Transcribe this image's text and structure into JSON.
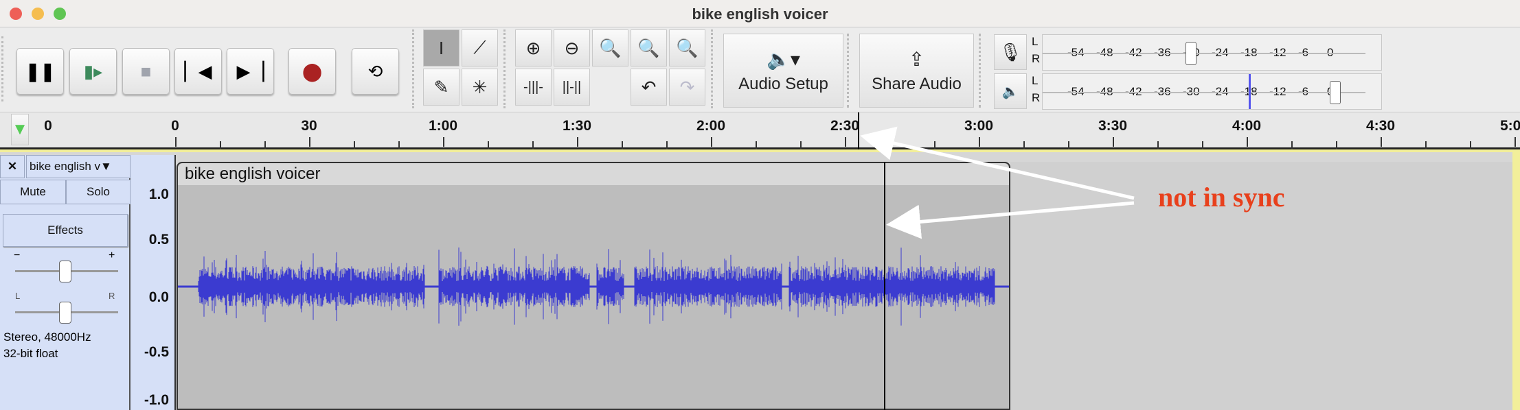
{
  "window": {
    "title": "bike english voicer",
    "traffic_lights": [
      "#ee5f57",
      "#f5bd4f",
      "#60c553"
    ]
  },
  "toolbar": {
    "audio_setup_label": "Audio Setup",
    "share_audio_label": "Share Audio",
    "meter_scale": [
      "-54",
      "-48",
      "-42",
      "-36",
      "-30",
      "-24",
      "-18",
      "-12",
      "-6",
      "0"
    ],
    "meter_channels": [
      "L",
      "R"
    ],
    "record_meter_level_db": -30,
    "playback_meter_level_db": 0,
    "playback_peak_db": -18
  },
  "ruler": {
    "labels": [
      "0",
      "0",
      "30",
      "1:00",
      "1:30",
      "2:00",
      "2:30",
      "3:00",
      "3:30",
      "4:00",
      "4:30",
      "5:00"
    ]
  },
  "track": {
    "name": "bike english v",
    "mute_label": "Mute",
    "solo_label": "Solo",
    "effects_label": "Effects",
    "gain_minus": "−",
    "gain_plus": "+",
    "pan_left": "L",
    "pan_right": "R",
    "format_line1": "Stereo, 48000Hz",
    "format_line2": "32-bit float",
    "scale_labels": [
      "1.0",
      "0.5",
      "0.0",
      "-0.5",
      "-1.0"
    ],
    "clip_name": "bike english voicer",
    "waveform_color": "#3b3bd0"
  },
  "annotation": {
    "text": "not in sync",
    "color": "#e8401c"
  }
}
